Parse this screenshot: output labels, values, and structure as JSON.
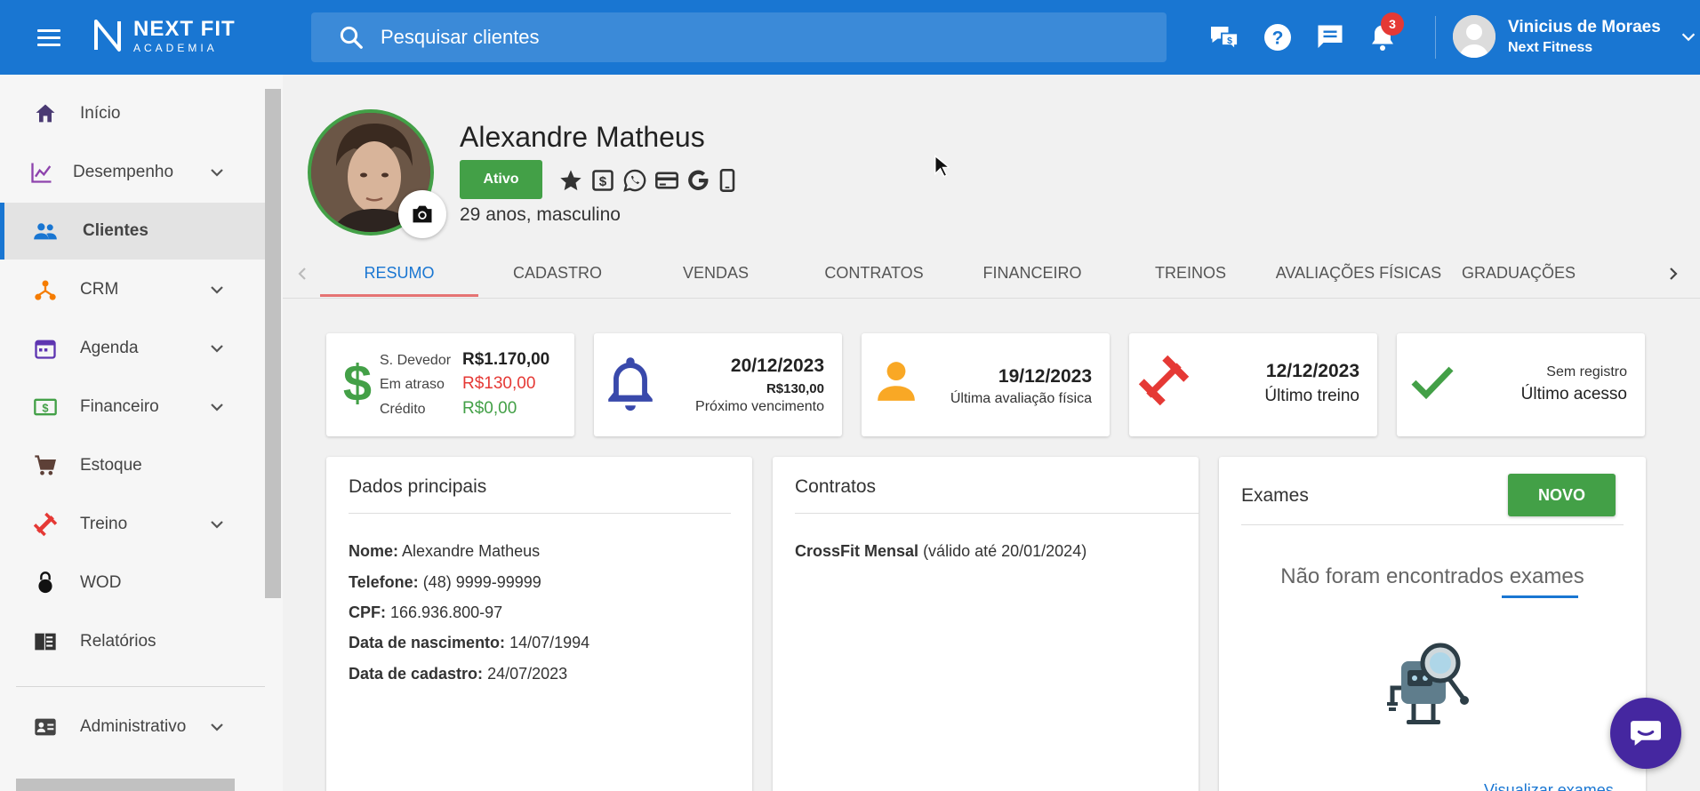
{
  "header": {
    "logo_line1": "NEXT FIT",
    "logo_line2": "ACADEMIA",
    "search_placeholder": "Pesquisar clientes",
    "notifications_count": "3",
    "user_name": "Vinicius de Moraes",
    "user_org": "Next Fitness",
    "accent": "#1976d2"
  },
  "sidebar": {
    "items": [
      {
        "label": "Início",
        "icon": "home-icon"
      },
      {
        "label": "Desempenho",
        "icon": "chart-line-icon"
      },
      {
        "label": "Clientes",
        "icon": "people-icon"
      },
      {
        "label": "CRM",
        "icon": "crm-hub-icon"
      },
      {
        "label": "Agenda",
        "icon": "calendar-icon"
      },
      {
        "label": "Financeiro",
        "icon": "money-icon"
      },
      {
        "label": "Estoque",
        "icon": "cart-icon"
      },
      {
        "label": "Treino",
        "icon": "dumbbell-icon"
      },
      {
        "label": "WOD",
        "icon": "kettlebell-icon"
      },
      {
        "label": "Relatórios",
        "icon": "report-icon"
      },
      {
        "label": "Administrativo",
        "icon": "id-card-icon"
      }
    ]
  },
  "client": {
    "name": "Alexandre Matheus",
    "status": "Ativo",
    "info": "29 anos, masculino"
  },
  "tabs": [
    "RESUMO",
    "CADASTRO",
    "VENDAS",
    "CONTRATOS",
    "FINANCEIRO",
    "TREINOS",
    "AVALIAÇÕES FÍSICAS",
    "GRADUAÇÕES"
  ],
  "kpis": {
    "balance": {
      "devedor_label": "S. Devedor",
      "devedor_value": "R$1.170,00",
      "atraso_label": "Em atraso",
      "atraso_value": "R$130,00",
      "credito_label": "Crédito",
      "credito_value": "R$0,00"
    },
    "vencimento": {
      "date": "20/12/2023",
      "value": "R$130,00",
      "label": "Próximo vencimento"
    },
    "avaliacao": {
      "date": "19/12/2023",
      "label": "Última avaliação física"
    },
    "treino": {
      "date": "12/12/2023",
      "label": "Último treino"
    },
    "acesso": {
      "value": "Sem registro",
      "label": "Último acesso"
    }
  },
  "dados": {
    "title": "Dados principais",
    "nome_label": "Nome:",
    "nome": "Alexandre Matheus",
    "telefone_label": "Telefone:",
    "telefone": "(48) 9999-99999",
    "cpf_label": "CPF:",
    "cpf": "166.936.800-97",
    "nasc_label": "Data de nascimento:",
    "nasc": "14/07/1994",
    "cad_label": "Data de cadastro:",
    "cad": "24/07/2023"
  },
  "contratos": {
    "title": "Contratos",
    "plan": "CrossFit Mensal",
    "validity": "(válido até 20/01/2024)"
  },
  "exames": {
    "title": "Exames",
    "new_label": "NOVO",
    "empty_text": "Não foram encontrados exames",
    "link": "Visualizar exames"
  }
}
